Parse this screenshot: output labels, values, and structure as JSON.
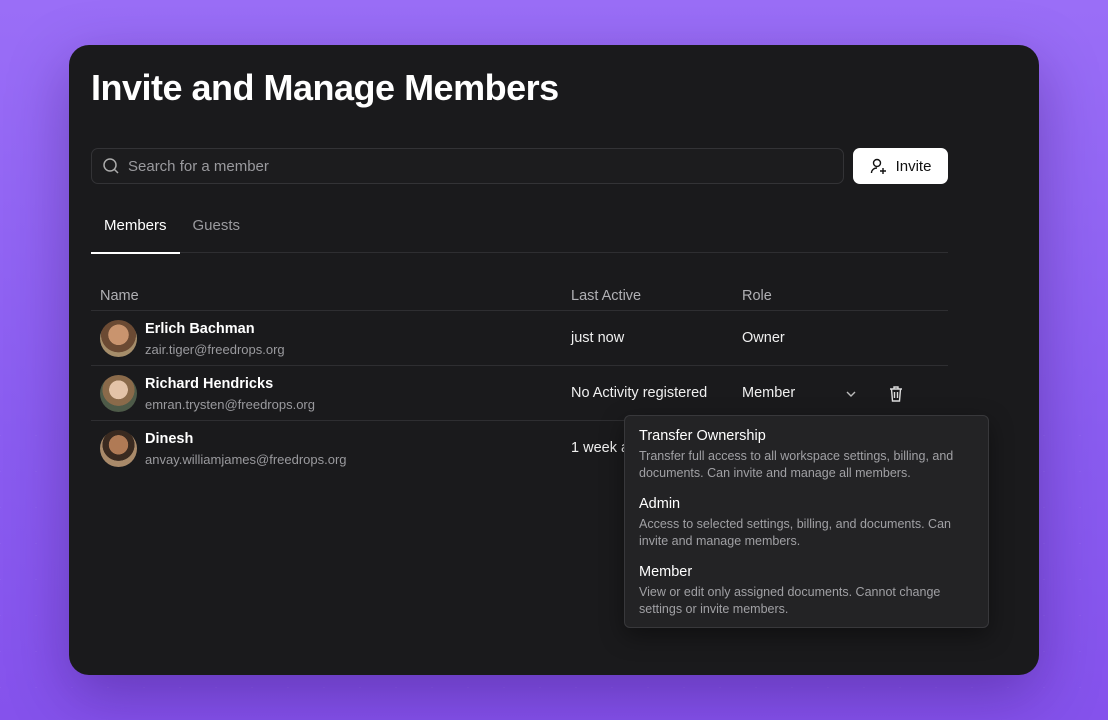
{
  "title": "Invite and Manage Members",
  "search": {
    "placeholder": "Search for a member",
    "value": ""
  },
  "invite_label": "Invite",
  "tabs": [
    {
      "label": "Members",
      "active": true
    },
    {
      "label": "Guests",
      "active": false
    }
  ],
  "columns": {
    "name": "Name",
    "last_active": "Last Active",
    "role": "Role"
  },
  "members": [
    {
      "name": "Erlich Bachman",
      "email": "zair.tiger@freedrops.org",
      "last_active": "just now",
      "role": "Owner"
    },
    {
      "name": "Richard Hendricks",
      "email": "emran.trysten@freedrops.org",
      "last_active": "No Activity registered",
      "role": "Member"
    },
    {
      "name": "Dinesh",
      "email": "anvay.williamjames@freedrops.org",
      "last_active": "1 week a"
    }
  ],
  "role_menu": [
    {
      "title": "Transfer Ownership",
      "desc": "Transfer full access to all workspace settings, billing, and documents. Can invite and manage all members."
    },
    {
      "title": "Admin",
      "desc": "Access to selected settings, billing, and documents. Can invite and manage members."
    },
    {
      "title": "Member",
      "desc": "View or edit only assigned documents. Cannot change settings or invite members."
    }
  ],
  "colors": {
    "background": "#8b5cf6",
    "card": "#1a1a1c",
    "button": "#ffffff"
  }
}
